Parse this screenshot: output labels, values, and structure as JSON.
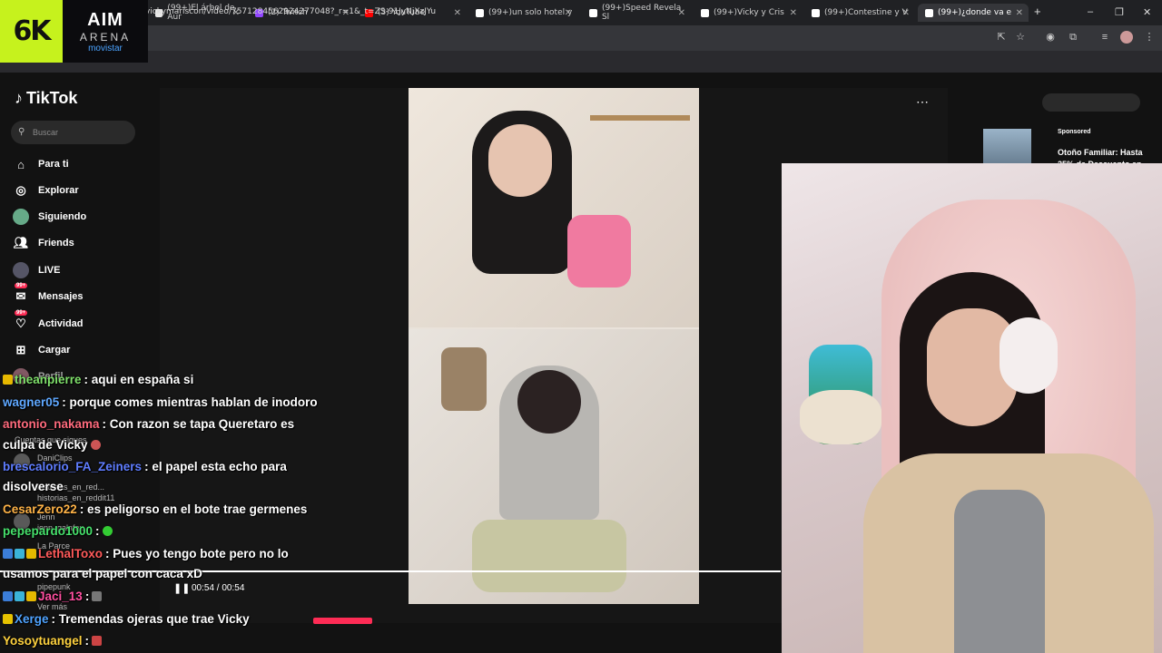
{
  "browser": {
    "tabs": [
      {
        "label": "(99+)El árbol de Aur",
        "color": "#e8e8e8"
      },
      {
        "label": "(2) Twitch",
        "color": "#9146ff"
      },
      {
        "label": "(3) YouTube",
        "color": "#ff0000"
      },
      {
        "label": "(99+)un solo hotel y",
        "color": "#ffffff"
      },
      {
        "label": "(99+)Speed Revela Sl",
        "color": "#ffffff"
      },
      {
        "label": "(99+)Vicky y Cris",
        "color": "#ffffff"
      },
      {
        "label": "(99+)Contestine y V",
        "color": "#ffffff"
      },
      {
        "label": "(99+)¿donde va e",
        "color": "#ffffff"
      }
    ],
    "new_tab": "+",
    "url": "vickymariscon/video/7571284562924277048?_r=1&_t=ZS-91JyNjXzJYu",
    "win_min": "–",
    "win_max": "❐",
    "win_close": "✕"
  },
  "overlay": {
    "logo_6k": "6K",
    "aim": "AIM",
    "arena": "ARENA",
    "sponsor": "movistar"
  },
  "tiktok": {
    "brand": "TikTok",
    "search_placeholder": "Buscar",
    "nav": [
      {
        "label": "Para ti",
        "icon": "home-icon"
      },
      {
        "label": "Explorar",
        "icon": "compass-icon"
      },
      {
        "label": "Siguiendo",
        "icon": "following-avatar-icon"
      },
      {
        "label": "Friends",
        "icon": "friends-icon"
      },
      {
        "label": "LIVE",
        "icon": "live-icon"
      },
      {
        "label": "Mensajes",
        "icon": "messages-icon",
        "badge": "99+"
      },
      {
        "label": "Actividad",
        "icon": "activity-icon",
        "badge": "99+"
      },
      {
        "label": "Cargar",
        "icon": "upload-icon"
      },
      {
        "label": "Perfil",
        "icon": "profile-icon"
      }
    ],
    "following_header": "Cuentas que sigues",
    "following": [
      "DaniClips",
      "historias_en_red...",
      "historias_en_reddit11",
      "Jenn",
      "jenn_galafox",
      "La Parce",
      "pipepunk"
    ],
    "see_more": "Ver más",
    "time": "00:54 / 00:54",
    "sponsored_label": "Sponsored",
    "sponsored_text": "Otoño Familiar: Hasta 25% de Descuento en"
  },
  "chat": [
    {
      "user": "theanpierre",
      "color": "#7fe06b",
      "text": ": aqui en españa si"
    },
    {
      "user": "wagner05",
      "color": "#5fa8ff",
      "text": ": porque comes mientras hablan de inodoro"
    },
    {
      "user": "antonio_nakama",
      "color": "#ff6b7d",
      "text": ": Con razon se tapa Queretaro es",
      "cont": "culpa de Vicky"
    },
    {
      "user": "brescalorio_FA_Zeiners",
      "color": "#5f7dff",
      "text": ": el papel esta echo para",
      "cont": "disolverse"
    },
    {
      "user": "CesarZero22",
      "color": "#ffb347",
      "text": ": es peligorso en el bote trae germenes"
    },
    {
      "user": "pepepardo1000",
      "color": "#46e06b",
      "text": ":"
    },
    {
      "user": "LethalToxo",
      "color": "#ff5a5a",
      "text": ": Pues yo tengo bote pero no lo",
      "cont": "usamos para el papel con caca xD"
    },
    {
      "user": "Jaci_13",
      "color": "#ff4fa0",
      "text": ":"
    },
    {
      "user": "Xerge",
      "color": "#4fa3ff",
      "text": ": Tremendas ojeras que trae Vicky"
    },
    {
      "user": "Yosoytuangel",
      "color": "#ffd23f",
      "text": ":"
    }
  ]
}
